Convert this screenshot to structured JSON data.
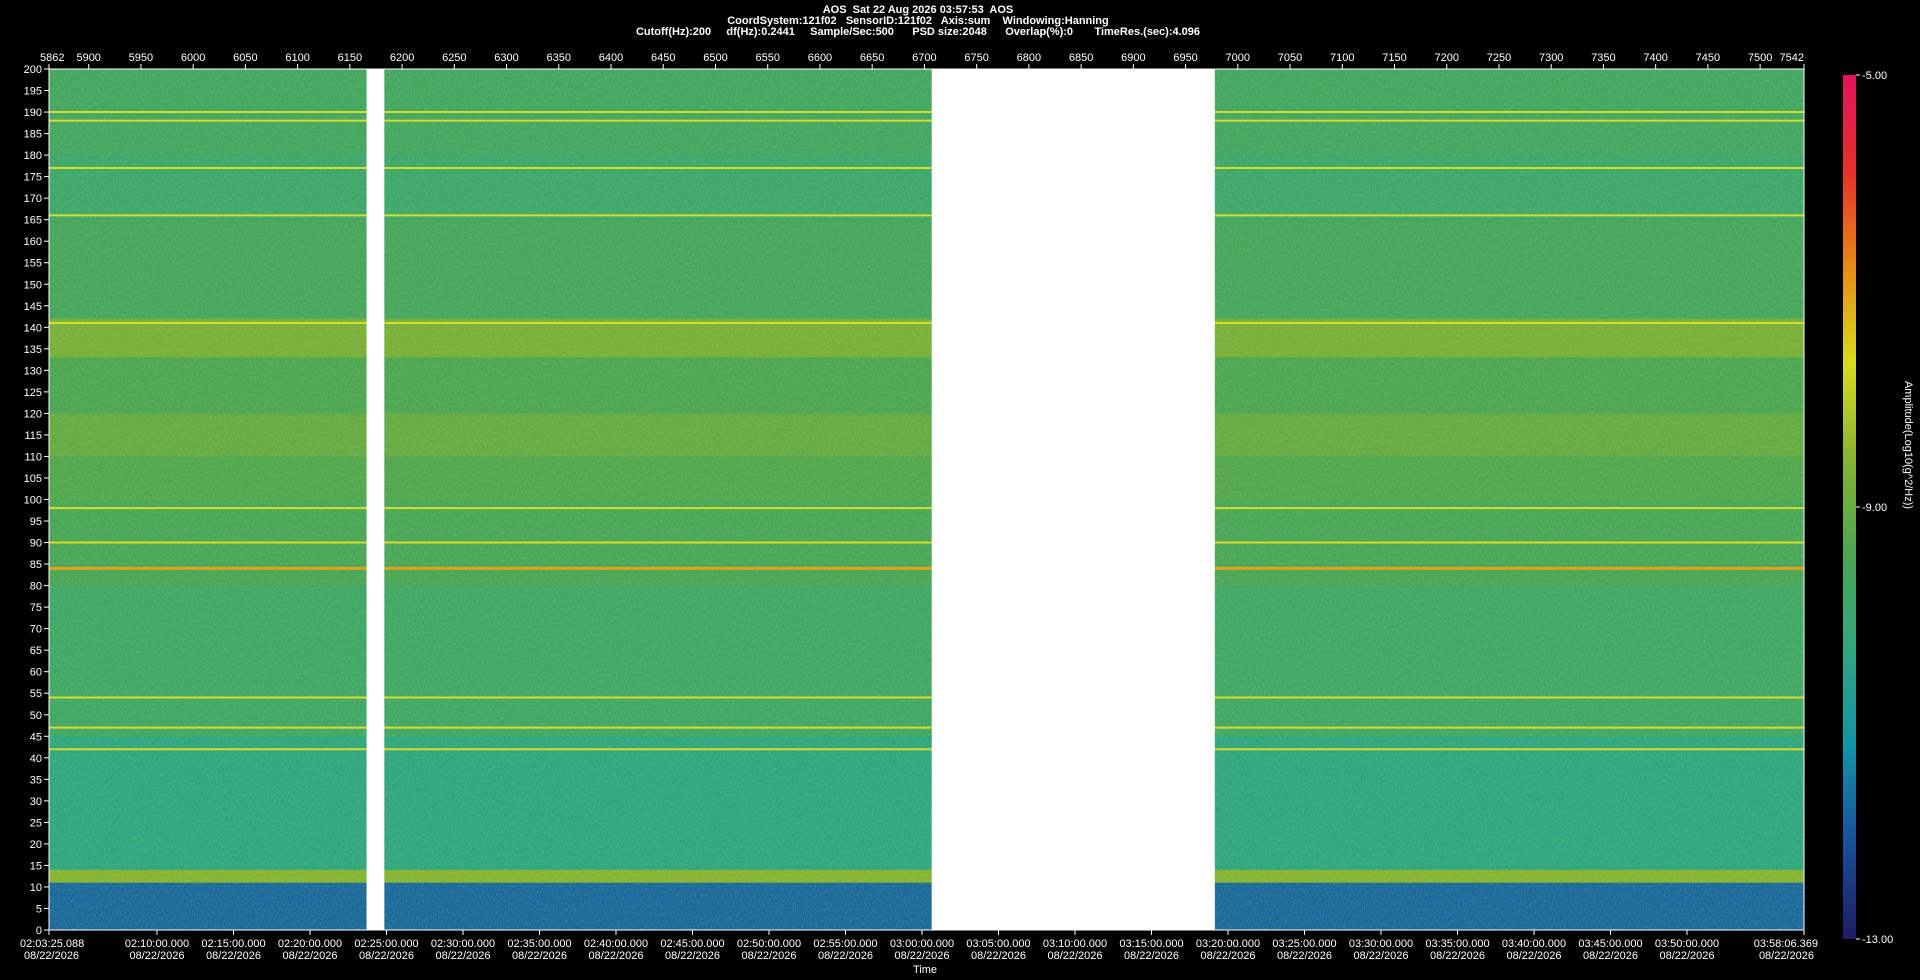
{
  "header": {
    "line1": "AOS  Sat 22 Aug 2026 03:57:53  AOS",
    "line2": "CoordSystem:121f02   SensorID:121f02   Axis:sum    Windowing:Hanning",
    "line3": "Cutoff(Hz):200     df(Hz):0.2441     Sample/Sec:500      PSD size:2048      Overlap(%):0       TimeRes.(sec):4.096"
  },
  "colors": {
    "background": "#000000",
    "axis_text": "#ffffff",
    "gap": "#ffffff",
    "colormap": [
      "#1e1c62",
      "#1a4f9a",
      "#1293a8",
      "#2fa67f",
      "#4ba552",
      "#86b332",
      "#d7dc1f",
      "#e78a14",
      "#e6302a",
      "#e0145c"
    ]
  },
  "chart_data": {
    "type": "heatmap",
    "xlabel": "Time",
    "ylabel": "",
    "colorbar_label": "Amplitude(Log10(g^2/Hz))",
    "colorbar_ticks": [
      "-5.00",
      "-9.00",
      "-13.00"
    ],
    "clim": [
      -13,
      -5
    ],
    "x_index_range": [
      5862,
      7542
    ],
    "top_tick_labels": [
      "5862",
      "5900",
      "5950",
      "6000",
      "6050",
      "6100",
      "6150",
      "6200",
      "6250",
      "6300",
      "6350",
      "6400",
      "6450",
      "6500",
      "6550",
      "6600",
      "6650",
      "6700",
      "6750",
      "6800",
      "6850",
      "6900",
      "6950",
      "7000",
      "7050",
      "7100",
      "7150",
      "7200",
      "7250",
      "7300",
      "7350",
      "7400",
      "7450",
      "7500",
      "7542"
    ],
    "top_tick_values": [
      5862,
      5900,
      5950,
      6000,
      6050,
      6100,
      6150,
      6200,
      6250,
      6300,
      6350,
      6400,
      6450,
      6500,
      6550,
      6600,
      6650,
      6700,
      6750,
      6800,
      6850,
      6900,
      6950,
      7000,
      7050,
      7100,
      7150,
      7200,
      7250,
      7300,
      7350,
      7400,
      7450,
      7500,
      7542
    ],
    "time_range": [
      "02:03:25.088",
      "03:58:06.369"
    ],
    "time_tick_labels": [
      "02:03:25.088",
      "02:10:00.000",
      "02:15:00.000",
      "02:20:00.000",
      "02:25:00.000",
      "02:30:00.000",
      "02:35:00.000",
      "02:40:00.000",
      "02:45:00.000",
      "02:50:00.000",
      "02:55:00.000",
      "03:00:00.000",
      "03:05:00.000",
      "03:10:00.000",
      "03:15:00.000",
      "03:20:00.000",
      "03:25:00.000",
      "03:30:00.000",
      "03:35:00.000",
      "03:40:00.000",
      "03:45:00.000",
      "03:50:00.000",
      "03:58:06.369"
    ],
    "date_label": "08/22/2026",
    "ylim": [
      0,
      200
    ],
    "y_ticks": [
      0,
      5,
      10,
      15,
      20,
      25,
      30,
      35,
      40,
      45,
      50,
      55,
      60,
      65,
      70,
      75,
      80,
      85,
      90,
      95,
      100,
      105,
      110,
      115,
      120,
      125,
      130,
      135,
      140,
      145,
      150,
      155,
      160,
      165,
      170,
      175,
      180,
      185,
      190,
      195,
      200
    ],
    "data_segments": [
      [
        5862,
        6166
      ],
      [
        6183,
        6707
      ],
      [
        6978,
        7542
      ]
    ],
    "no_data_segments": [
      [
        6166,
        6183
      ],
      [
        6707,
        6978
      ]
    ],
    "spectral_lines_hz": [
      190,
      188,
      177,
      166,
      141,
      98,
      90,
      84,
      54,
      47,
      42
    ],
    "bands": [
      {
        "from_hz": 0,
        "to_hz": 11,
        "level": -11.8
      },
      {
        "from_hz": 11,
        "to_hz": 14,
        "level": -8.6
      },
      {
        "from_hz": 14,
        "to_hz": 45,
        "level": -10.4
      },
      {
        "from_hz": 45,
        "to_hz": 80,
        "level": -9.9
      },
      {
        "from_hz": 80,
        "to_hz": 100,
        "level": -9.6
      },
      {
        "from_hz": 100,
        "to_hz": 110,
        "level": -9.4
      },
      {
        "from_hz": 110,
        "to_hz": 120,
        "level": -9.1
      },
      {
        "from_hz": 120,
        "to_hz": 133,
        "level": -9.5
      },
      {
        "from_hz": 133,
        "to_hz": 142,
        "level": -8.8
      },
      {
        "from_hz": 142,
        "to_hz": 165,
        "level": -9.7
      },
      {
        "from_hz": 165,
        "to_hz": 180,
        "level": -10.0
      },
      {
        "from_hz": 180,
        "to_hz": 200,
        "level": -9.8
      }
    ]
  }
}
